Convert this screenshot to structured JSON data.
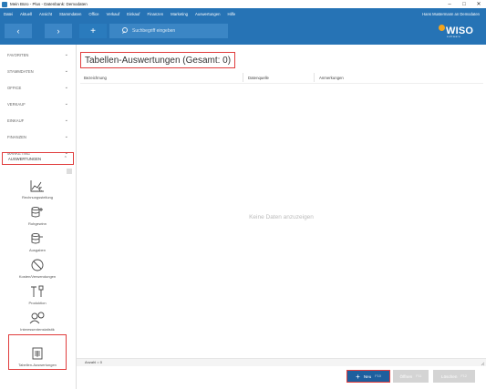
{
  "window": {
    "title": "Mein Büro - Plus - Datenbank: Demodaten",
    "controls": [
      "–",
      "□",
      "✕"
    ]
  },
  "menu": {
    "items": [
      "Datei",
      "Aktuell",
      "Ansicht",
      "Stammdaten",
      "Office",
      "Verkauf",
      "Einkauf",
      "Finanzen",
      "Marketing",
      "Auswertungen",
      "Hilfe"
    ],
    "user": "Hans Mustermann an Demodaten"
  },
  "toolbar": {
    "back": "‹",
    "forward": "›",
    "add": "+",
    "search_placeholder": "Suchbegriff eingeben",
    "logo_word": "WISO",
    "logo_sub": "software"
  },
  "sidebar": {
    "sections": [
      {
        "label": "FAVORITEN",
        "chevron": "⌄"
      },
      {
        "label": "STAMMDATEN",
        "chevron": "⌄"
      },
      {
        "label": "OFFICE",
        "chevron": "⌄"
      },
      {
        "label": "VERKAUF",
        "chevron": "⌄"
      },
      {
        "label": "EINKAUF",
        "chevron": "⌄"
      },
      {
        "label": "FINANZEN",
        "chevron": "⌄"
      },
      {
        "label": "MARKETING",
        "chevron": "⌄"
      },
      {
        "label": "AUSWERTUNGEN",
        "chevron": "⌃"
      }
    ],
    "items": [
      {
        "label": "Rechnungsstellung",
        "icon": "chart-euro-icon"
      },
      {
        "label": "Rohgewinn",
        "icon": "database-plus-icon"
      },
      {
        "label": "Ausgaben",
        "icon": "database-minus-icon"
      },
      {
        "label": "Kosten/Verwendungen",
        "icon": "no-sign-icon"
      },
      {
        "label": "Produktion",
        "icon": "tools-icon"
      },
      {
        "label": "Interessentenstatistik",
        "icon": "people-icon"
      },
      {
        "label": "Tabellen-Auswertungen",
        "icon": "table-document-icon"
      }
    ]
  },
  "main": {
    "title": "Tabellen-Auswertungen (Gesamt: 0)",
    "columns": [
      "Bezeichnung",
      "Datenquelle",
      "Anmerkungen"
    ],
    "empty_text": "Keine Daten anzuzeigen",
    "count": "Anzahl = 0"
  },
  "actions": {
    "new_icon": "+",
    "new_label": "Neu",
    "new_key": "F10",
    "open_label": "Öffnen",
    "open_key": "F11",
    "delete_label": "Löschen",
    "delete_key": "F12"
  },
  "colors": {
    "brand_blue": "#2673b5",
    "highlight_red": "#e03c3c",
    "primary_button": "#1e5f9e",
    "logo_accent": "#f3a51e"
  }
}
